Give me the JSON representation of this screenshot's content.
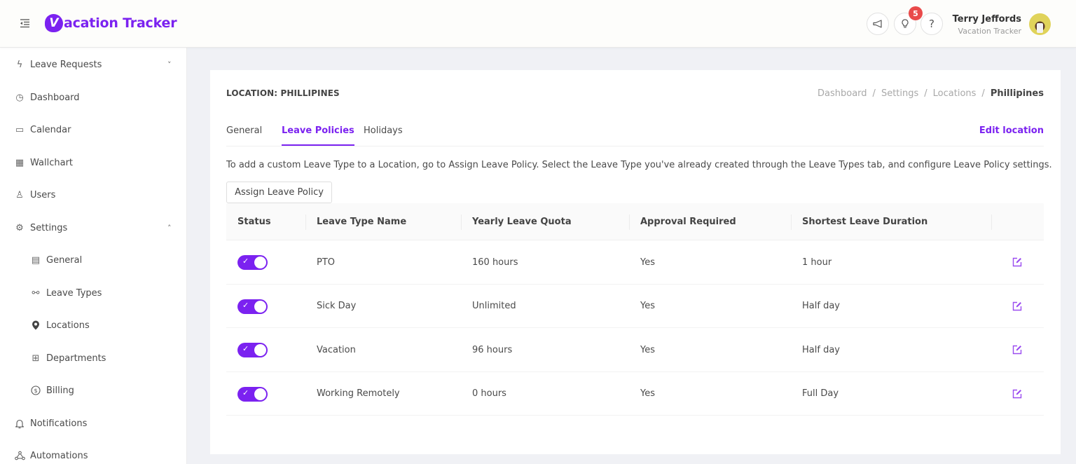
{
  "app": {
    "name": "Vacation Tracker",
    "logo_letter": "V",
    "logo_text": "acation Tracker"
  },
  "header": {
    "icons": [
      "menu-fold-icon",
      "megaphone-icon",
      "lightbulb-icon",
      "help-icon"
    ],
    "help_glyph": "?",
    "notification_count": "5",
    "user": {
      "name": "Terry Jeffords",
      "org": "Vacation Tracker"
    }
  },
  "sidebar": {
    "items": [
      {
        "label": "Leave Requests",
        "icon": "lightning-icon",
        "glyph": "ϟ",
        "chevron": "˅"
      },
      {
        "label": "Dashboard",
        "icon": "dashboard-icon",
        "glyph": "◷"
      },
      {
        "label": "Calendar",
        "icon": "calendar-icon",
        "glyph": "▭"
      },
      {
        "label": "Wallchart",
        "icon": "table-icon",
        "glyph": "▦"
      },
      {
        "label": "Users",
        "icon": "user-icon",
        "glyph": "♙"
      },
      {
        "label": "Settings",
        "icon": "gear-icon",
        "glyph": "⚙",
        "chevron": "˄"
      },
      {
        "label": "General",
        "icon": "list-icon",
        "glyph": "▤"
      },
      {
        "label": "Leave Types",
        "icon": "branches-icon",
        "glyph": "⚯"
      },
      {
        "label": "Locations",
        "icon": "location-pin-icon",
        "glyph": "●"
      },
      {
        "label": "Departments",
        "icon": "departments-icon",
        "glyph": "⊞"
      },
      {
        "label": "Billing",
        "icon": "dollar-icon",
        "glyph": "$"
      },
      {
        "label": "Notifications",
        "icon": "bell-icon",
        "glyph": "♫"
      },
      {
        "label": "Automations",
        "icon": "automation-icon",
        "glyph": "⁂"
      }
    ]
  },
  "main": {
    "location_title": "LOCATION: PHILLIPINES",
    "breadcrumb": [
      "Dashboard",
      "Settings",
      "Locations",
      "Phillipines"
    ],
    "breadcrumb_sep": "/",
    "tabs": [
      {
        "label": "General",
        "active": false
      },
      {
        "label": "Leave Policies",
        "active": true
      },
      {
        "label": "Holidays",
        "active": false
      }
    ],
    "edit_location_label": "Edit location",
    "hint": "To add a custom Leave Type to a Location, go to Assign Leave Policy. Select the Leave Type you've already created through the Leave Types tab, and configure Leave Policy settings.",
    "assign_button_label": "Assign Leave Policy",
    "accent_color": "#7b22f0",
    "table": {
      "columns": [
        "Status",
        "Leave Type Name",
        "Yearly Leave Quota",
        "Approval Required",
        "Shortest Leave Duration",
        ""
      ],
      "rows": [
        {
          "status": true,
          "name": "PTO",
          "quota": "160 hours",
          "approval": "Yes",
          "shortest": "1 hour"
        },
        {
          "status": true,
          "name": "Sick Day",
          "quota": "Unlimited",
          "approval": "Yes",
          "shortest": "Half day"
        },
        {
          "status": true,
          "name": "Vacation",
          "quota": "96 hours",
          "approval": "Yes",
          "shortest": "Half day"
        },
        {
          "status": true,
          "name": "Working Remotely",
          "quota": "0 hours",
          "approval": "Yes",
          "shortest": "Full Day"
        }
      ],
      "toggle_check_glyph": "✓"
    }
  }
}
